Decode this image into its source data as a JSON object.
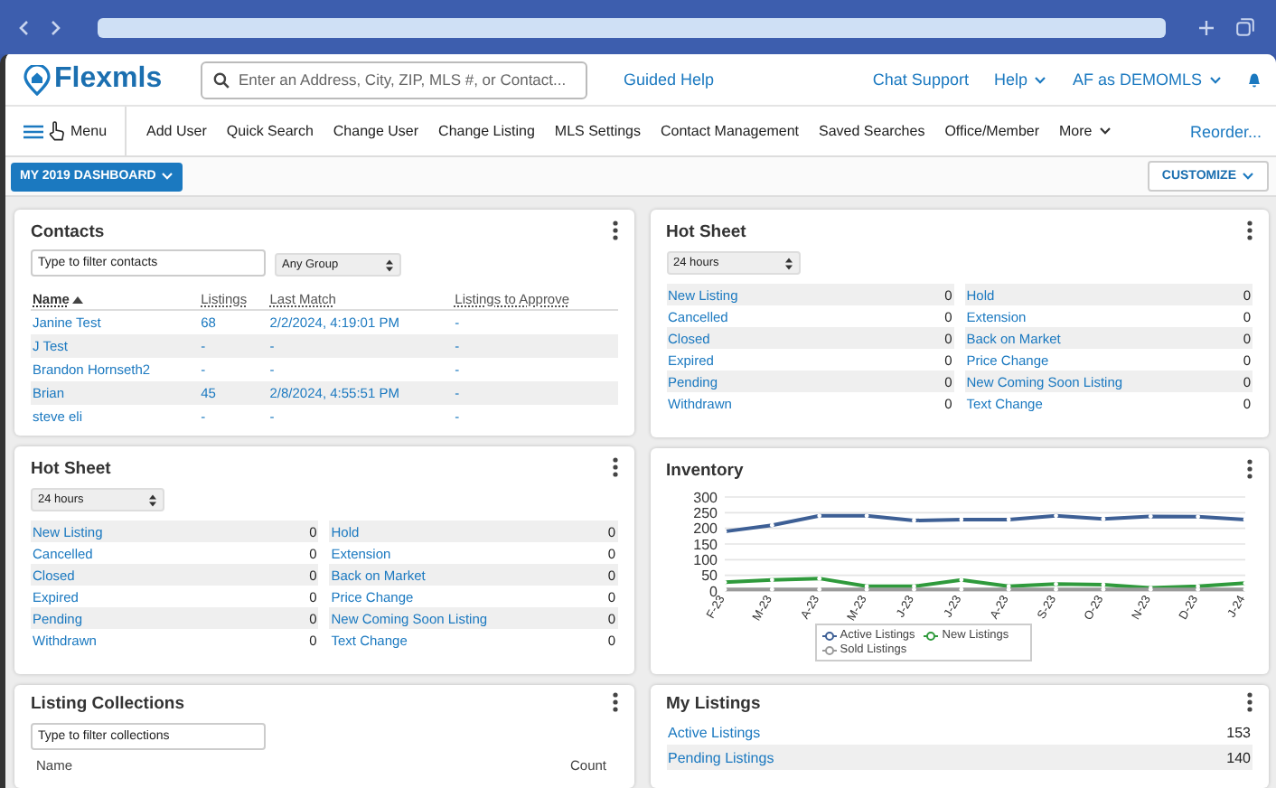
{
  "header": {
    "logo": "Flexmls",
    "search": {
      "placeholder": "Enter an Address, City, ZIP, MLS #, or Contact..."
    },
    "guided_help": "Guided Help",
    "links": [
      {
        "label": "Chat Support",
        "dropdown": false
      },
      {
        "label": "Help",
        "dropdown": true
      },
      {
        "label": "AF as DEMOMLS",
        "dropdown": true
      }
    ]
  },
  "nav": {
    "menu": "Menu",
    "items": [
      {
        "label": "Add User",
        "dropdown": false
      },
      {
        "label": "Quick Search",
        "dropdown": false
      },
      {
        "label": "Change User",
        "dropdown": false
      },
      {
        "label": "Change Listing",
        "dropdown": false
      },
      {
        "label": "MLS Settings",
        "dropdown": false
      },
      {
        "label": "Contact Management",
        "dropdown": false
      },
      {
        "label": "Saved Searches",
        "dropdown": false
      },
      {
        "label": "Office/Member",
        "dropdown": false
      },
      {
        "label": "More",
        "dropdown": true
      }
    ],
    "reorder": "Reorder..."
  },
  "dashboard": {
    "selector": "MY 2019 DASHBOARD",
    "customize": "CUSTOMIZE"
  },
  "contacts": {
    "title": "Contacts",
    "filter": {
      "placeholder": "Type to filter contacts"
    },
    "group": "Any Group",
    "columns": [
      {
        "label": "Name",
        "sorted": true
      },
      {
        "label": "Listings",
        "sorted": false
      },
      {
        "label": "Last Match",
        "sorted": false
      },
      {
        "label": "Listings to Approve",
        "sorted": false
      }
    ],
    "rows": [
      [
        "Janine Test",
        "68",
        "2/2/2024, 4:19:01 PM",
        "-"
      ],
      [
        "J Test",
        "-",
        "-",
        "-"
      ],
      [
        "Brandon Hornseth2",
        "-",
        "-",
        "-"
      ],
      [
        "Brian",
        "45",
        "2/8/2024, 4:55:51 PM",
        "-"
      ],
      [
        "steve eli",
        "-",
        "-",
        "-"
      ]
    ]
  },
  "hot_sheet_right": {
    "title": "Hot Sheet",
    "period": "24 hours",
    "columns": [
      [
        {
          "label": "New Listing",
          "count": "0"
        },
        {
          "label": "Cancelled",
          "count": "0"
        },
        {
          "label": "Closed",
          "count": "0"
        },
        {
          "label": "Expired",
          "count": "0"
        },
        {
          "label": "Pending",
          "count": "0"
        },
        {
          "label": "Withdrawn",
          "count": "0"
        }
      ],
      [
        {
          "label": "Hold",
          "count": "0"
        },
        {
          "label": "Extension",
          "count": "0"
        },
        {
          "label": "Back on Market",
          "count": "0"
        },
        {
          "label": "Price Change",
          "count": "0"
        },
        {
          "label": "New Coming Soon Listing",
          "count": "0"
        },
        {
          "label": "Text Change",
          "count": "0"
        }
      ]
    ]
  },
  "hot_sheet_left": {
    "title": "Hot Sheet",
    "period": "24 hours",
    "columns": [
      [
        {
          "label": "New Listing",
          "count": "0"
        },
        {
          "label": "Cancelled",
          "count": "0"
        },
        {
          "label": "Closed",
          "count": "0"
        },
        {
          "label": "Expired",
          "count": "0"
        },
        {
          "label": "Pending",
          "count": "0"
        },
        {
          "label": "Withdrawn",
          "count": "0"
        }
      ],
      [
        {
          "label": "Hold",
          "count": "0"
        },
        {
          "label": "Extension",
          "count": "0"
        },
        {
          "label": "Back on Market",
          "count": "0"
        },
        {
          "label": "Price Change",
          "count": "0"
        },
        {
          "label": "New Coming Soon Listing",
          "count": "0"
        },
        {
          "label": "Text Change",
          "count": "0"
        }
      ]
    ]
  },
  "inventory": {
    "title": "Inventory",
    "chart_data": {
      "type": "line",
      "grid": true,
      "legend": true,
      "categories": [
        "F-23",
        "M-23",
        "A-23",
        "M-23",
        "J-23",
        "J-23",
        "A-23",
        "S-23",
        "O-23",
        "N-23",
        "D-23",
        "J-24"
      ],
      "ylim": [
        0,
        300
      ],
      "yticks": [
        0,
        50,
        100,
        150,
        200,
        250,
        300
      ],
      "series": [
        {
          "name": "Active Listings",
          "color": "#3d5f95",
          "values": [
            190,
            210,
            240,
            240,
            225,
            228,
            228,
            240,
            230,
            238,
            237,
            228
          ]
        },
        {
          "name": "New Listings",
          "color": "#2f9a3c",
          "values": [
            28,
            35,
            40,
            15,
            15,
            35,
            15,
            22,
            20,
            10,
            15,
            25
          ]
        },
        {
          "name": "Sold Listings",
          "color": "#9a9a9a",
          "values": [
            5,
            5,
            5,
            5,
            5,
            5,
            5,
            5,
            5,
            5,
            5,
            5
          ]
        }
      ]
    }
  },
  "listing_collections": {
    "title": "Listing Collections",
    "filter": {
      "placeholder": "Type to filter collections"
    },
    "columns": [
      "Name",
      "Count"
    ]
  },
  "my_listings": {
    "title": "My Listings",
    "rows": [
      {
        "label": "Active Listings",
        "count": "153"
      },
      {
        "label": "Pending Listings",
        "count": "140"
      }
    ]
  }
}
